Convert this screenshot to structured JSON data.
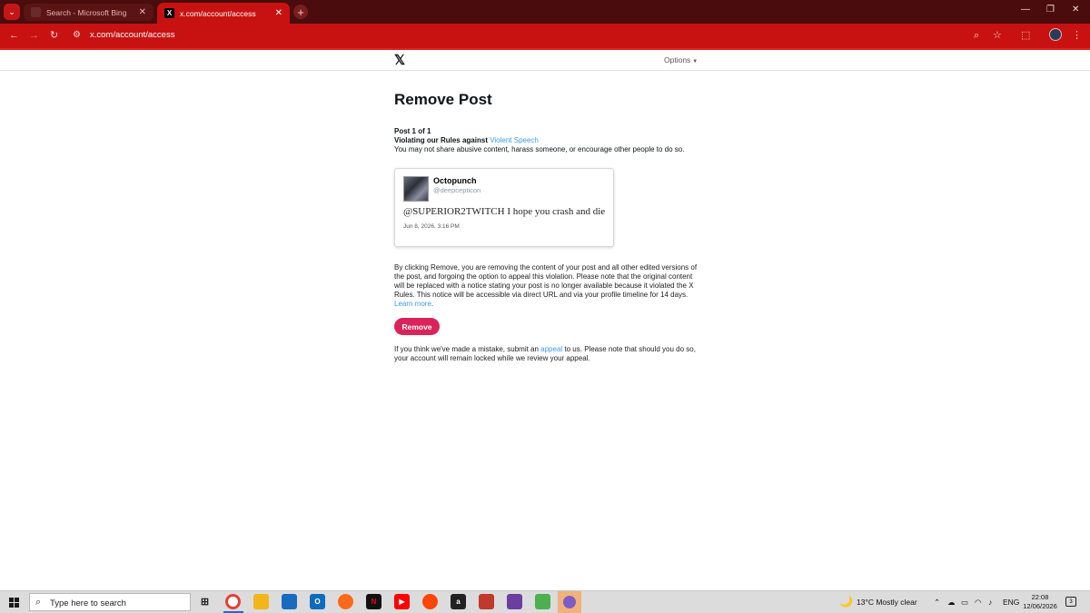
{
  "browser": {
    "tabs": [
      {
        "title": "Search - Microsoft Bing",
        "close": "✕"
      },
      {
        "title": "x.com/account/access",
        "close": "✕"
      }
    ],
    "new_tab": "+",
    "url": "x.com/account/access",
    "window_controls": {
      "minimize": "—",
      "maximize": "❐",
      "close": "✕"
    }
  },
  "header": {
    "logo": "𝕏",
    "options": "Options"
  },
  "main": {
    "title": "Remove Post",
    "post_count": "Post 1 of 1",
    "violating_prefix": "Violating our Rules against ",
    "violating_link": "Violent Speech",
    "rule_description": "You may not share abusive content, harass someone, or encourage other people to do so."
  },
  "post": {
    "author": "Octopunch",
    "handle": "@deepcepticon",
    "text": "@SUPERIOR2TWITCH I hope you crash and die",
    "date": "Jun 8, 2026, 3:16 PM"
  },
  "explanation": {
    "text": "By clicking Remove, you are removing the content of your post and all other edited versions of the post, and forgoing the option to appeal this violation. Please note that the original content will be replaced with a notice stating your post is no longer available because it violated the X Rules. This notice will be accessible via direct URL and via your profile timeline for 14 days. ",
    "learn_more": "Learn more",
    "period": "."
  },
  "remove_button": "Remove",
  "appeal": {
    "prefix": "If you think we've made a mistake, submit an ",
    "link": "appeal",
    "suffix": " to us. Please note that should you do so, your account will remain locked while we review your appeal."
  },
  "taskbar": {
    "search_placeholder": "Type here to search",
    "weather": "13°C  Mostly clear",
    "language": "ENG",
    "time": "22:08",
    "date": "12/06/2026",
    "notification_count": "3"
  },
  "colors": {
    "browser_accent": "#c81212",
    "remove_button": "#d9245a",
    "link": "#3c9be6"
  }
}
